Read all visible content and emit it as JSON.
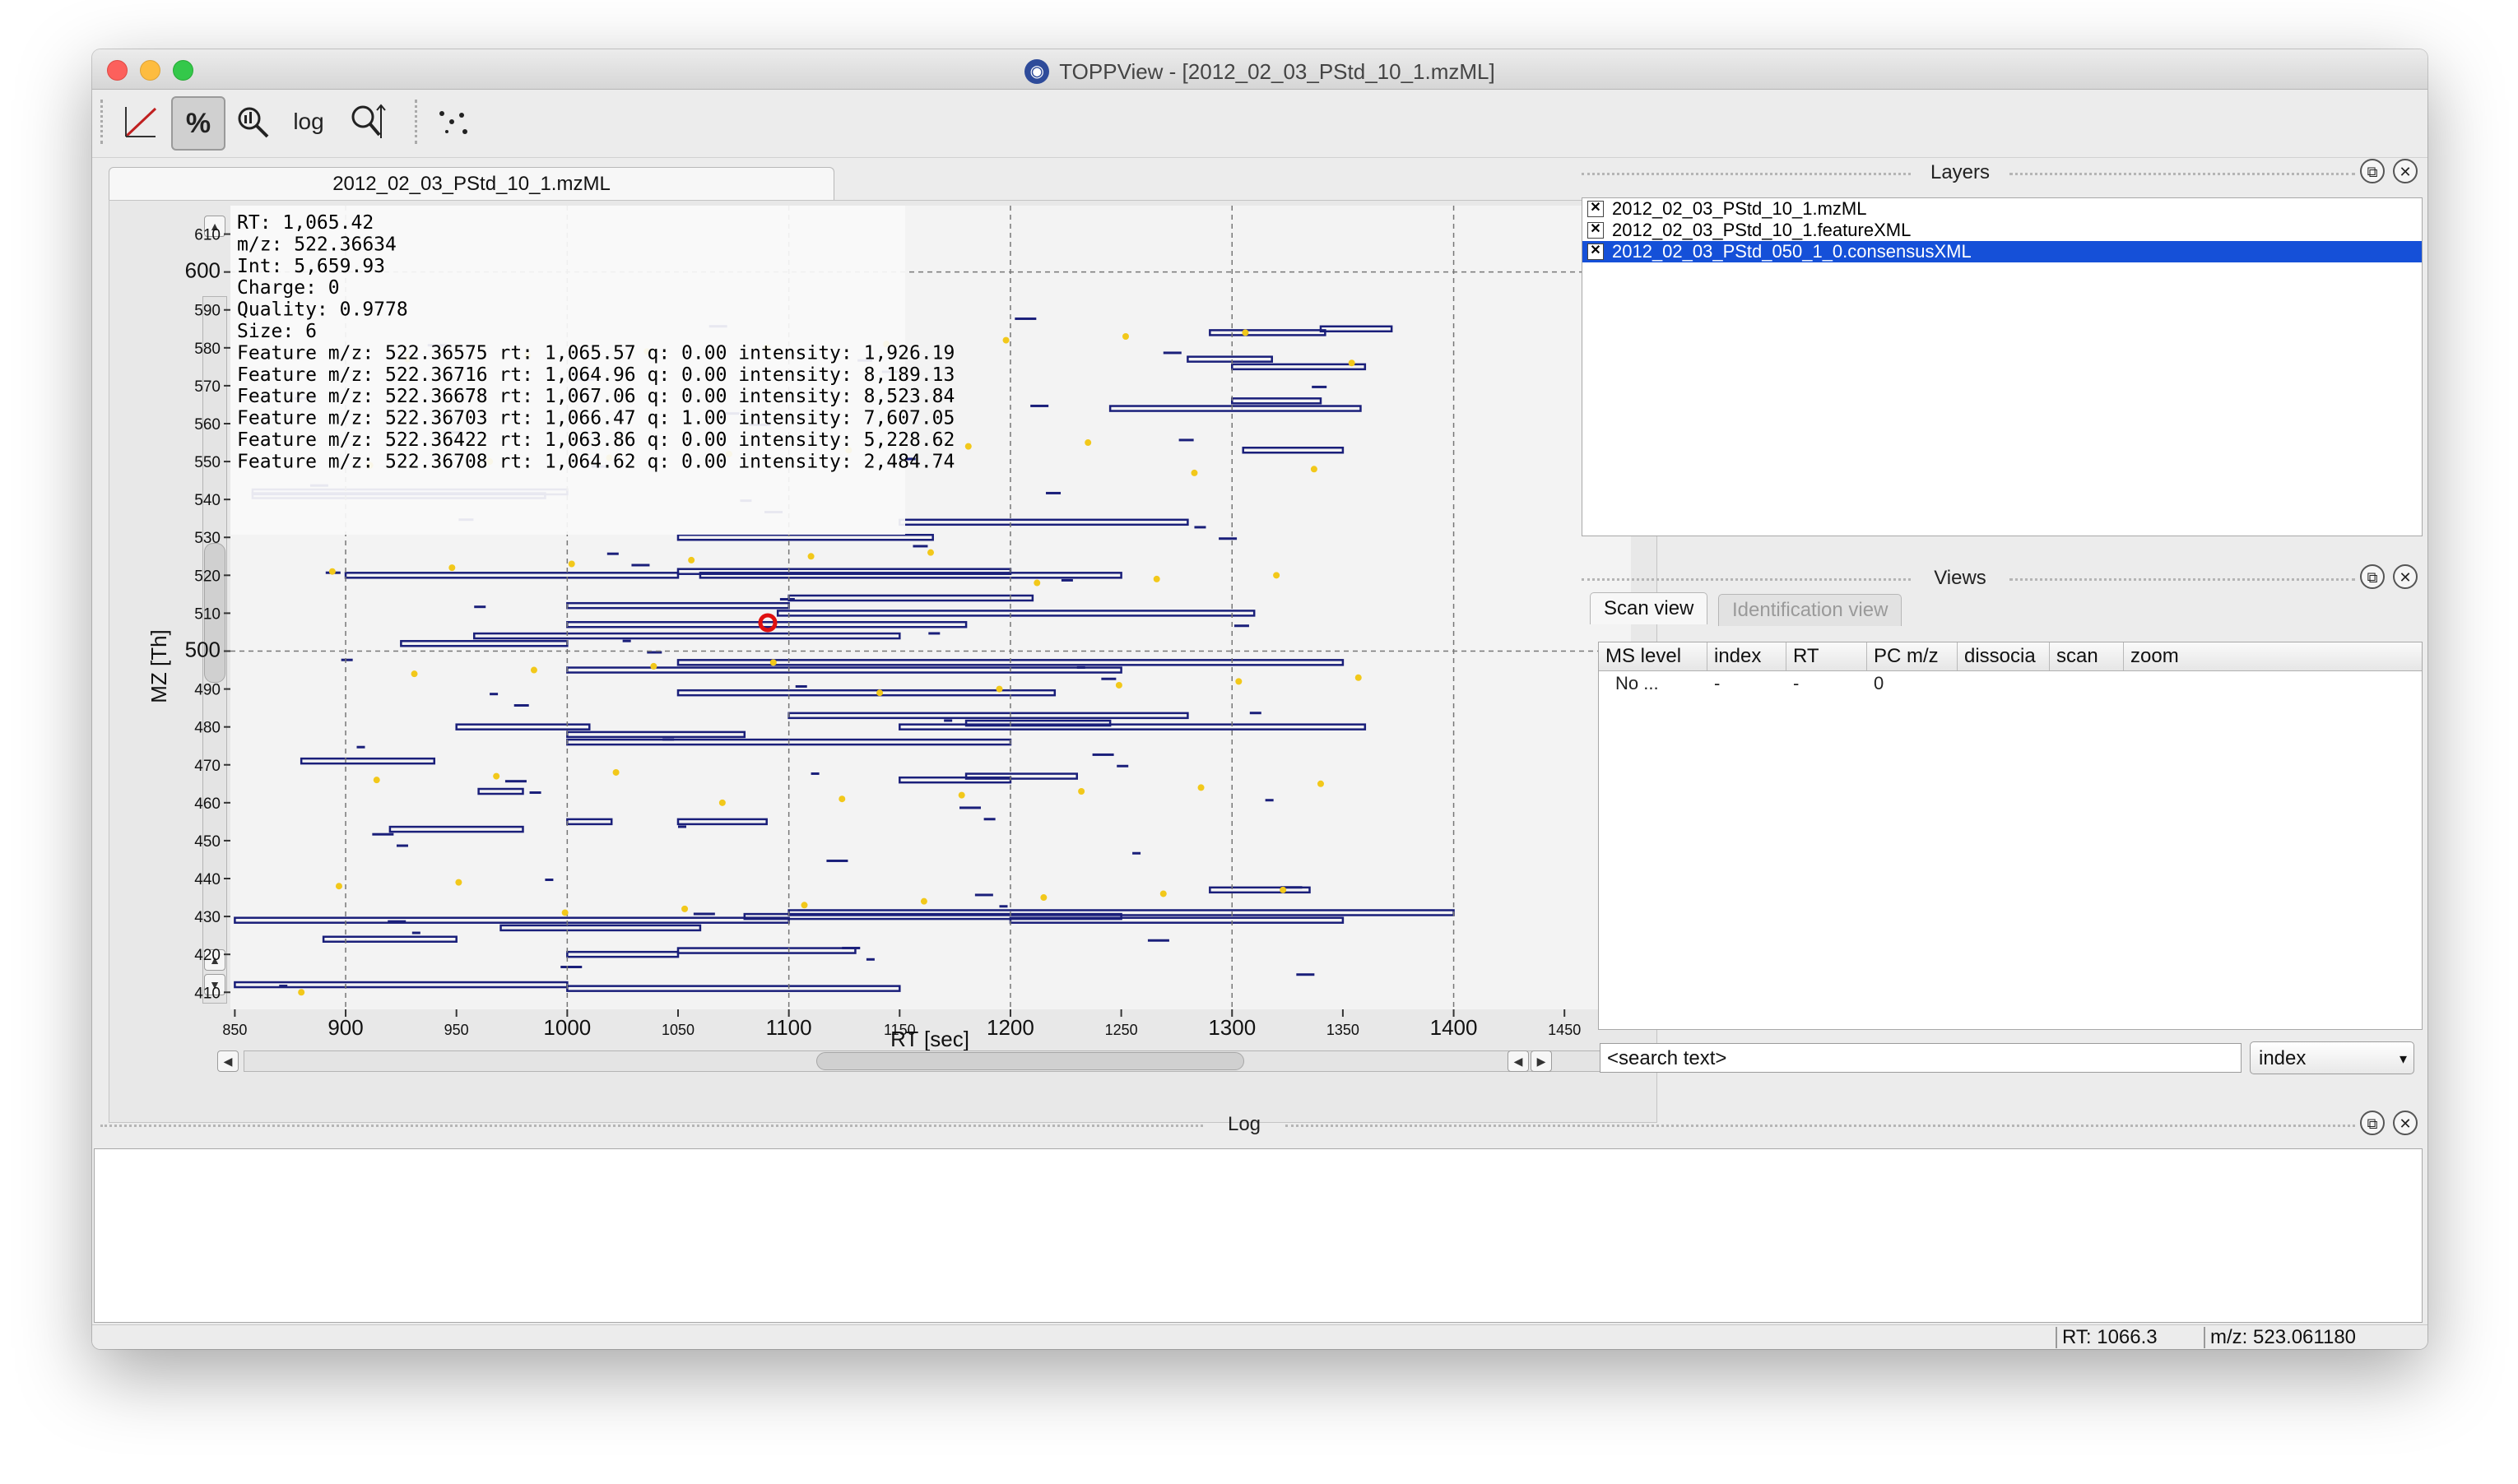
{
  "window": {
    "title": "TOPPView - [2012_02_03_PStd_10_1.mzML]"
  },
  "toolbar": {
    "buttons": [
      {
        "name": "linear-intensity",
        "icon": "linear-scale-icon"
      },
      {
        "name": "percentage-intensity",
        "icon": "percent-icon",
        "label": "%",
        "active": true
      },
      {
        "name": "snap-intensity",
        "icon": "zoom-icon"
      },
      {
        "name": "log-intensity",
        "icon": "log-icon",
        "label": "log"
      },
      {
        "name": "reset-zoom",
        "icon": "reset-zoom-icon"
      },
      {
        "name": "show-projections",
        "icon": "projection-icon"
      }
    ]
  },
  "document_tab": {
    "label": "2012_02_03_PStd_10_1.mzML"
  },
  "plot": {
    "x_label": "RT [sec]",
    "y_label": "MZ [Th]",
    "x_ticks": [
      "850",
      "900",
      "950",
      "1000",
      "1050",
      "1100",
      "1150",
      "1200",
      "1250",
      "1300",
      "1350",
      "1400",
      "1450"
    ],
    "y_ticks": [
      "410",
      "420",
      "430",
      "440",
      "450",
      "460",
      "470",
      "480",
      "490",
      "500",
      "510",
      "520",
      "530",
      "540",
      "550",
      "560",
      "570",
      "580",
      "590",
      "600",
      "610"
    ],
    "info_lines": [
      "RT:  1,065.42",
      "m/z: 522.36634",
      "Int: 5,659.93",
      "Charge: 0",
      "Quality: 0.9778",
      "Size: 6",
      "Feature m/z: 522.36575  rt: 1,065.57   q: 0.00  intensity: 1,926.19",
      "Feature m/z: 522.36716  rt: 1,064.96   q: 0.00  intensity: 8,189.13",
      "Feature m/z: 522.36678  rt: 1,067.06   q: 0.00  intensity: 8,523.84",
      "Feature m/z: 522.36703  rt: 1,066.47   q: 1.00  intensity: 7,607.05",
      "Feature m/z: 522.36422  rt: 1,063.86   q: 0.00  intensity: 5,228.62",
      "Feature m/z: 522.36708  rt: 1,064.62   q: 0.00  intensity: 2,484.74"
    ]
  },
  "layers": {
    "title": "Layers",
    "items": [
      {
        "label": "2012_02_03_PStd_10_1.mzML",
        "checked": true,
        "selected": false
      },
      {
        "label": "2012_02_03_PStd_10_1.featureXML",
        "checked": true,
        "selected": false
      },
      {
        "label": "2012_02_03_PStd_050_1_0.consensusXML",
        "checked": true,
        "selected": true
      }
    ]
  },
  "views": {
    "title": "Views",
    "tabs": [
      "Scan view",
      "Identification view"
    ],
    "columns": [
      "MS level",
      "index",
      "RT",
      "PC m/z",
      "dissocia",
      "scan",
      "zoom"
    ],
    "rows": [
      [
        "No ...",
        "-",
        "-",
        "0",
        "",
        "",
        ""
      ]
    ],
    "search_placeholder": "<search text>",
    "search_field": "index"
  },
  "log": {
    "title": "Log"
  },
  "status": {
    "rt": "RT:  1066.3",
    "mz": "m/z: 523.061180"
  },
  "colors": {
    "selection": "#1550d8",
    "feature_box": "#1a1f7a",
    "peak": "#f2c81a",
    "highlight": "#e01010"
  }
}
